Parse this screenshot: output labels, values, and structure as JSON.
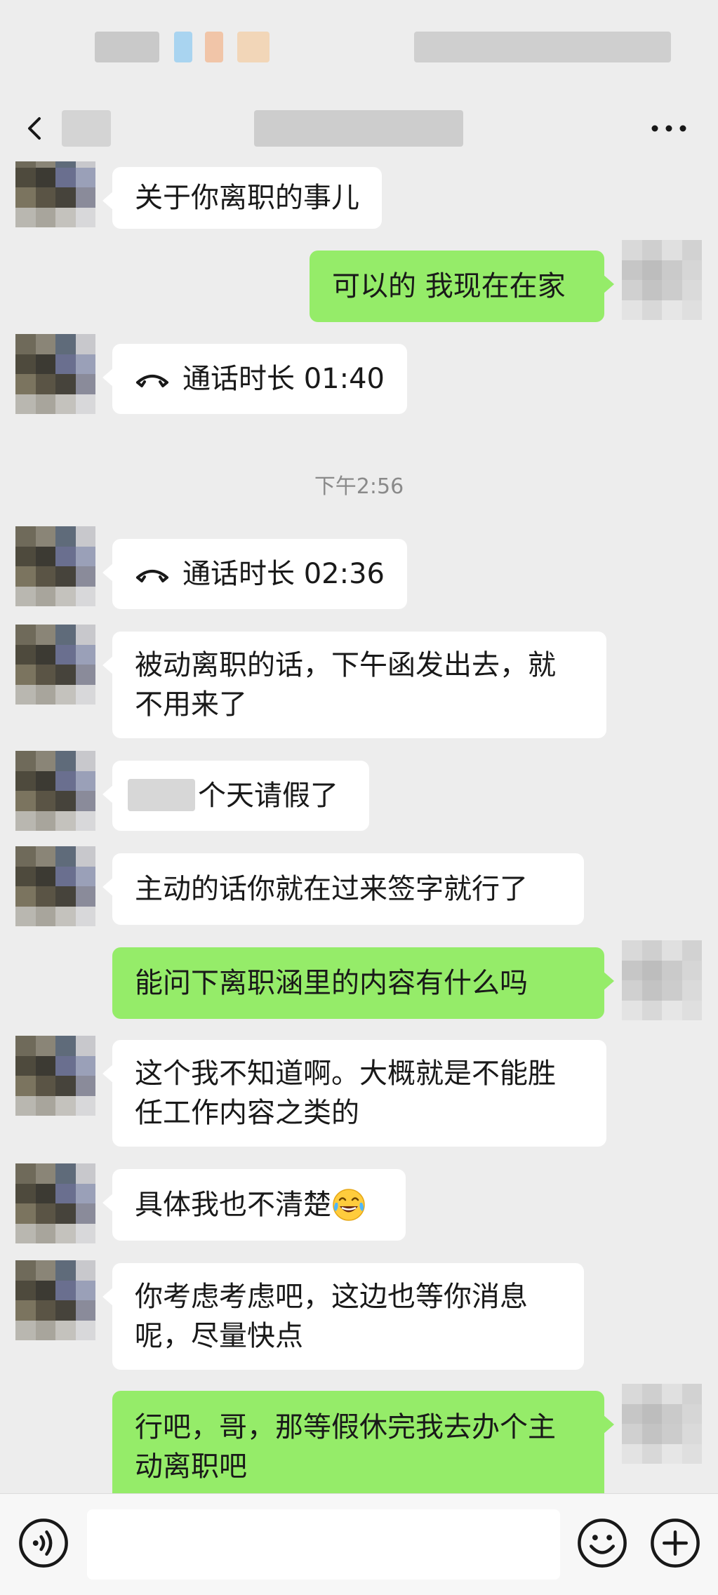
{
  "colors": {
    "background": "#ededed",
    "incoming_bubble": "#ffffff",
    "outgoing_bubble": "#95ec69",
    "timestamp_text": "#8a8a8a"
  },
  "nav": {
    "back_icon": "back-chevron-icon",
    "more_icon": "more-dots-icon"
  },
  "messages": [
    {
      "side": "left",
      "text": "关于你离职的事儿"
    },
    {
      "side": "right",
      "text": "可以的 我现在在家"
    },
    {
      "side": "left",
      "type": "call",
      "text": "通话时长 01:40"
    },
    {
      "side": "left",
      "type": "call",
      "text": "通话时长 02:36"
    },
    {
      "side": "left",
      "text": "被动离职的话，下午函发出去，就\n不用来了"
    },
    {
      "side": "left",
      "text": "个天请假了"
    },
    {
      "side": "left",
      "text": "主动的话你就在过来签字就行了"
    },
    {
      "side": "right",
      "text": "能问下离职涵里的内容有什么吗"
    },
    {
      "side": "left",
      "text": "这个我不知道啊。大概就是不能胜\n任工作内容之类的"
    },
    {
      "side": "left",
      "text": "具体我也不清楚",
      "emoji": "tears-of-joy-emoji"
    },
    {
      "side": "left",
      "text": "你考虑考虑吧，这边也等你消息\n呢，尽量快点"
    },
    {
      "side": "right",
      "text": "行吧，哥，那等假休完我去办个主\n动离职吧"
    }
  ],
  "timestamp": "下午2:56",
  "input_bar": {
    "voice_icon": "voice-icon",
    "emoji_icon": "emoji-icon",
    "plus_icon": "plus-icon",
    "input_value": ""
  }
}
